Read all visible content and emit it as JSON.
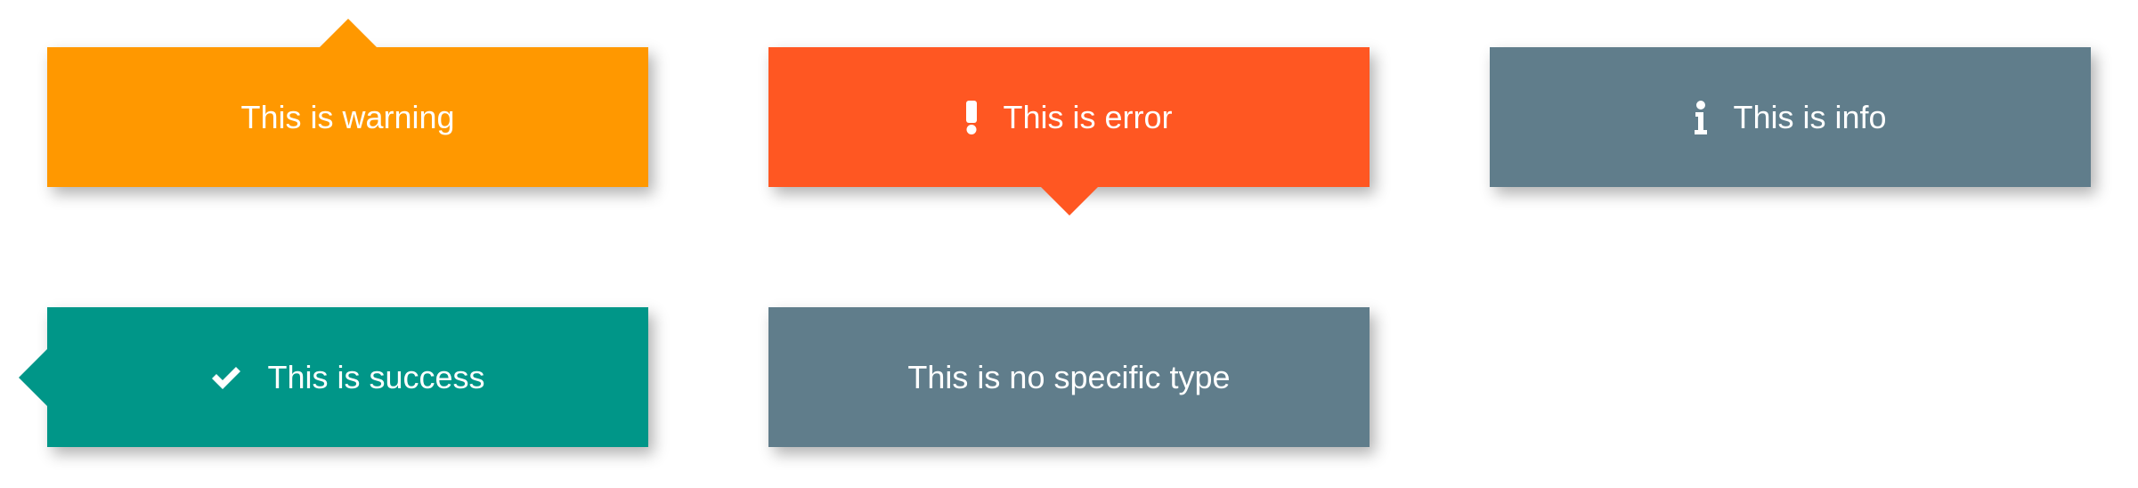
{
  "toasts": {
    "warning": {
      "text": "This is warning",
      "color": "#FF9800",
      "icon": "none",
      "arrow": "top"
    },
    "error": {
      "text": "This is error",
      "color": "#FF5722",
      "icon": "exclamation-icon",
      "arrow": "bottom"
    },
    "info": {
      "text": "This is info",
      "color": "#607D8B",
      "icon": "info-icon",
      "arrow": "none"
    },
    "success": {
      "text": "This is success",
      "color": "#009688",
      "icon": "checkmark-icon",
      "arrow": "left"
    },
    "plain": {
      "text": "This is no specific type",
      "color": "#607D8B",
      "icon": "none",
      "arrow": "none"
    }
  }
}
